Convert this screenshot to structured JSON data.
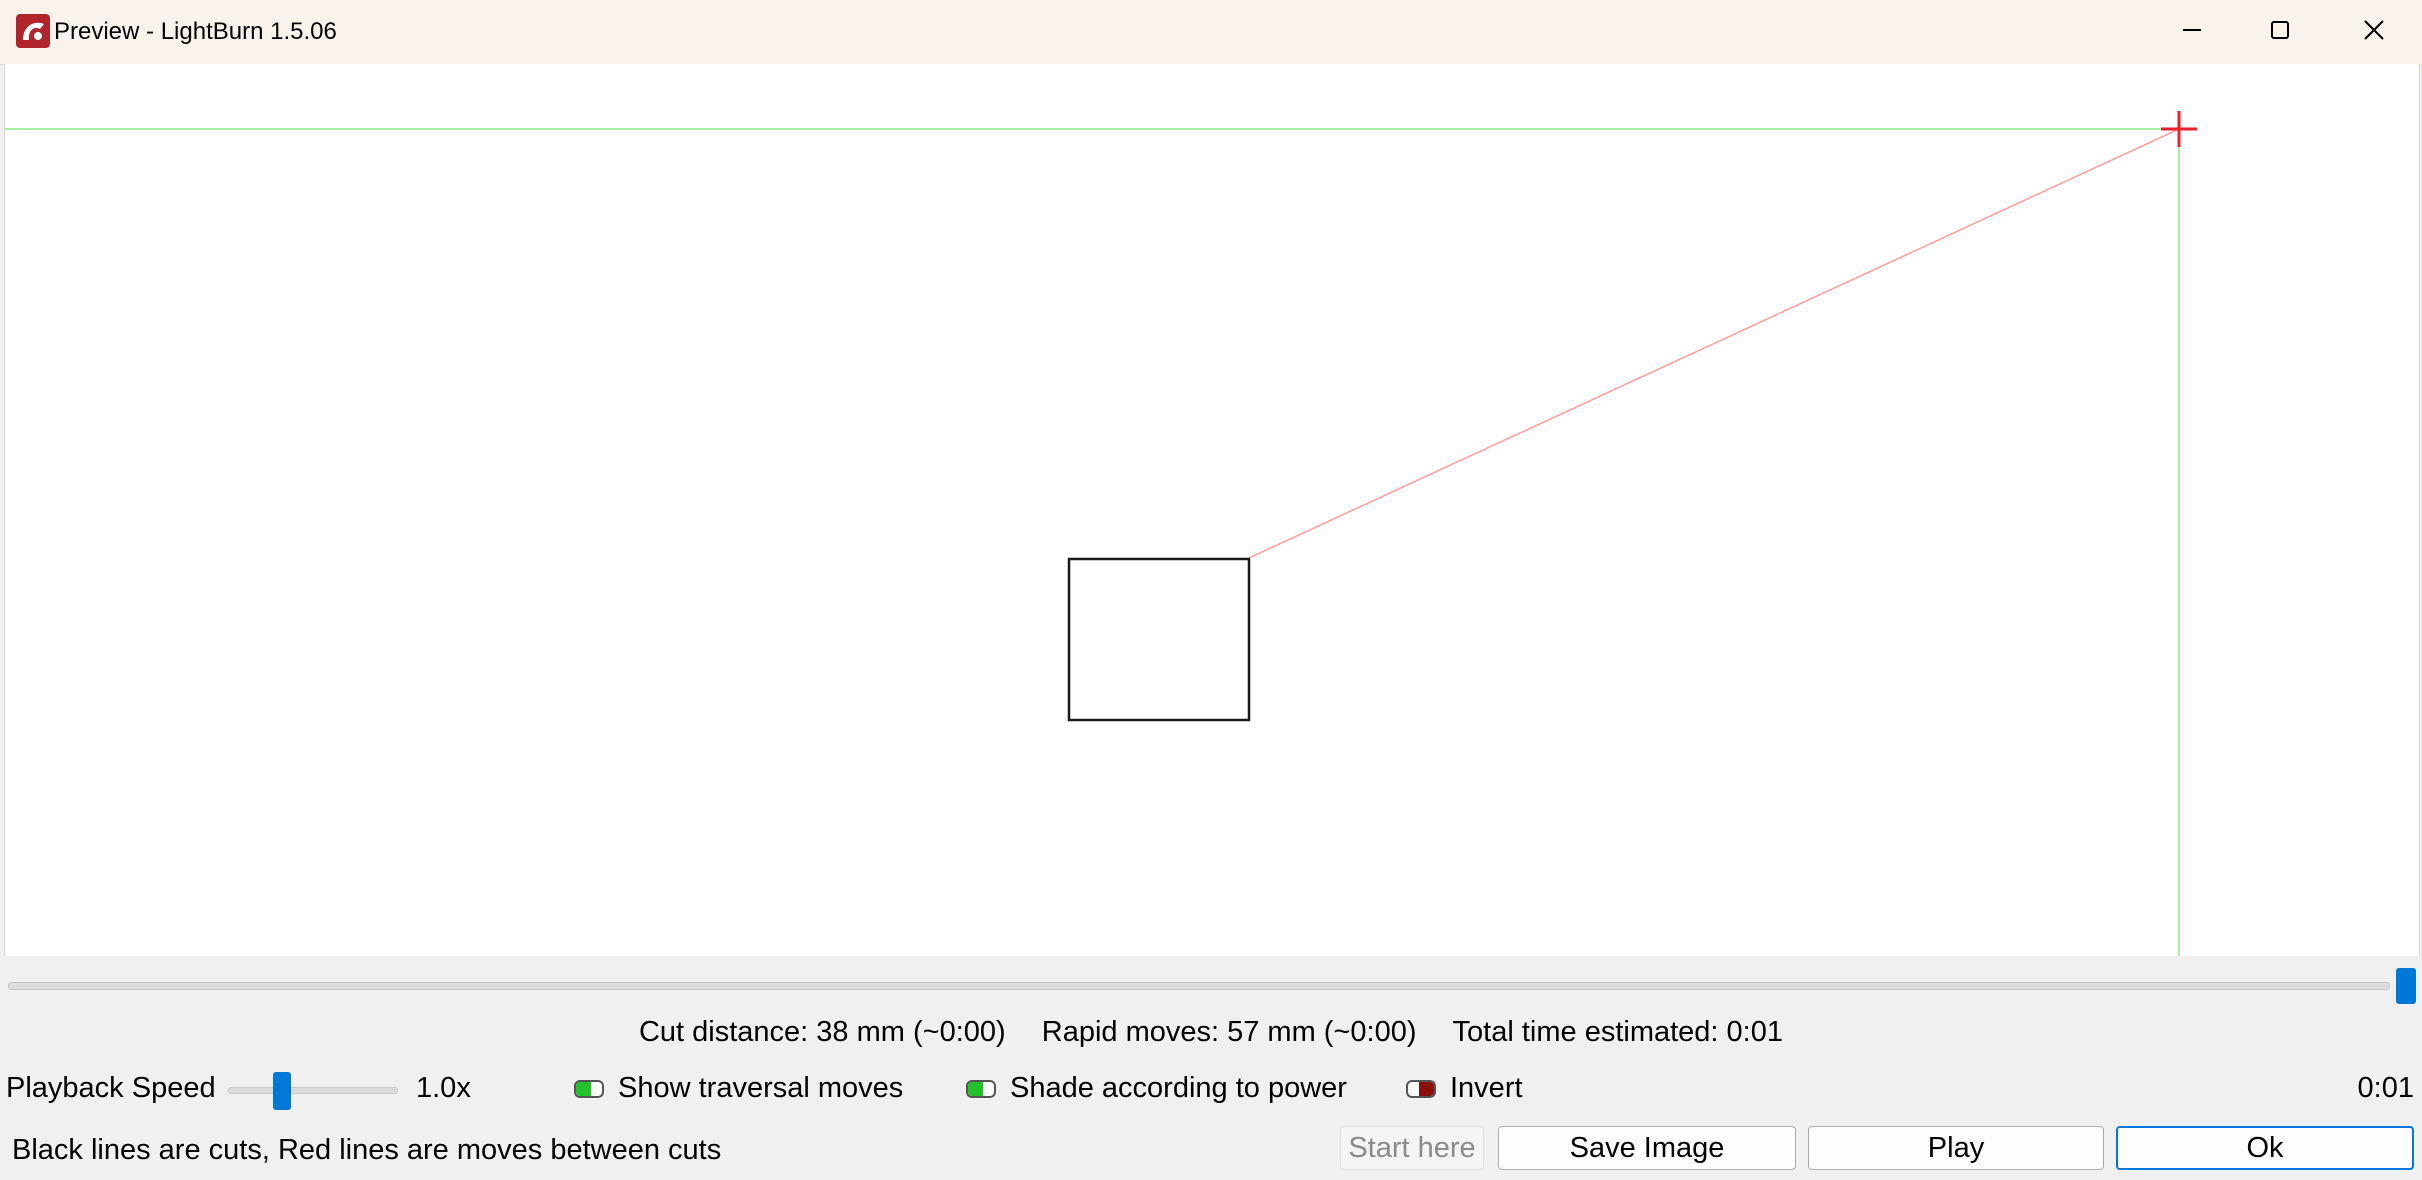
{
  "window": {
    "title": "Preview - LightBurn 1.5.06",
    "minimize_icon": "minimize-icon",
    "maximize_icon": "maximize-icon",
    "close_icon": "close-icon"
  },
  "preview": {
    "origin_marker_icon": "crosshair-icon",
    "colors": {
      "guide": "#a8f0a8",
      "rapid_move": "#ff9a9a",
      "cut": "#1a1a1a",
      "origin_marker": "#e8222a"
    }
  },
  "timeline": {
    "progress": 1.0
  },
  "stats": {
    "cut_distance": "Cut distance: 38 mm (~0:00)",
    "rapid_moves": "Rapid moves: 57 mm (~0:00)",
    "total_time": "Total time estimated: 0:01"
  },
  "controls": {
    "playback_speed_label": "Playback Speed",
    "playback_speed_value": "1.0x",
    "playback_speed_level": 0.3,
    "show_traversal": {
      "label": "Show traversal moves",
      "on": true
    },
    "shade_power": {
      "label": "Shade according to power",
      "on": true
    },
    "invert": {
      "label": "Invert",
      "on": false
    },
    "elapsed_time": "0:01"
  },
  "footer": {
    "hint": "Black lines are cuts, Red lines are moves between cuts",
    "start_here": "Start here",
    "save_image": "Save Image",
    "play": "Play",
    "ok": "Ok"
  },
  "colors": {
    "accent": "#0078d7",
    "toggle_on": "#22c32a",
    "toggle_off": "#8b0f0f"
  }
}
